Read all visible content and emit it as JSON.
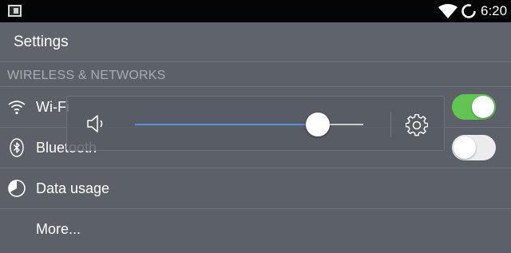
{
  "status_bar": {
    "time": "6:20",
    "icons": [
      "notification-icon",
      "wifi-signal-icon",
      "sync-ring-icon"
    ]
  },
  "header": {
    "title": "Settings"
  },
  "section": {
    "title": "WIRELESS & NETWORKS"
  },
  "rows": [
    {
      "label": "Wi-Fi",
      "icon": "wifi-icon",
      "toggle": "on"
    },
    {
      "label": "Bluetooth",
      "icon": "bluetooth-icon",
      "toggle": "off"
    },
    {
      "label": "Data usage",
      "icon": "data-usage-icon"
    },
    {
      "label": "More...",
      "icon": ""
    }
  ],
  "volume": {
    "level": 0.8,
    "icons": [
      "speaker-icon",
      "gear-icon"
    ]
  },
  "colors": {
    "toggle_on": "#62c553",
    "slider_fill": "#4f93e0",
    "background": "#5c6068"
  }
}
